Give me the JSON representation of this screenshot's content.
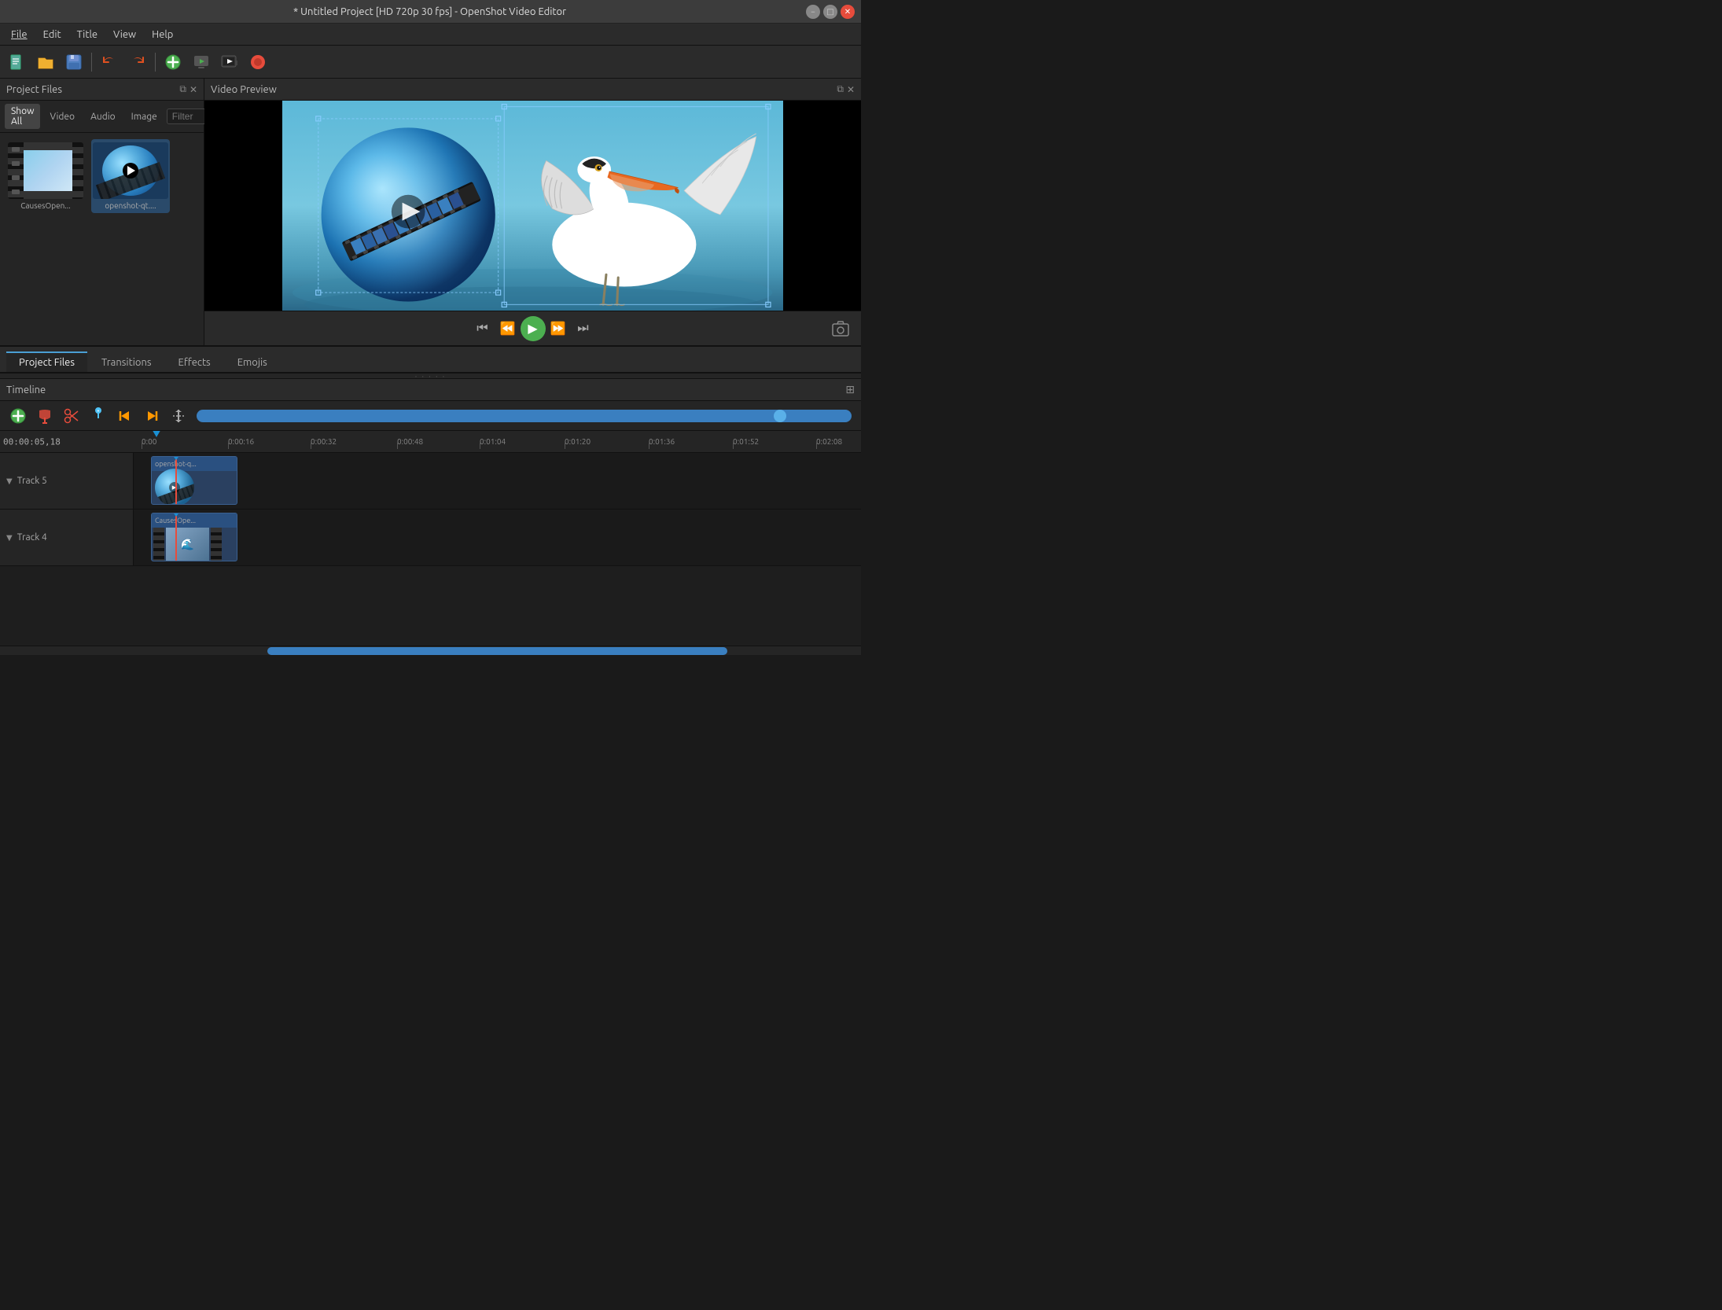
{
  "window": {
    "title": "* Untitled Project [HD 720p 30 fps] - OpenShot Video Editor",
    "minimize": "−",
    "maximize": "□",
    "close": "✕"
  },
  "menubar": {
    "items": [
      "File",
      "Edit",
      "Title",
      "View",
      "Help"
    ]
  },
  "toolbar": {
    "buttons": [
      {
        "name": "new",
        "icon": "📄",
        "label": "New"
      },
      {
        "name": "open",
        "icon": "📂",
        "label": "Open"
      },
      {
        "name": "save",
        "icon": "💾",
        "label": "Save"
      },
      {
        "name": "undo",
        "icon": "↩",
        "label": "Undo"
      },
      {
        "name": "redo",
        "icon": "↪",
        "label": "Redo"
      },
      {
        "name": "add",
        "icon": "➕",
        "label": "Add"
      },
      {
        "name": "preview",
        "icon": "▶",
        "label": "Preview"
      },
      {
        "name": "export",
        "icon": "📽",
        "label": "Export"
      },
      {
        "name": "record",
        "icon": "⏺",
        "label": "Record"
      }
    ]
  },
  "project_files_panel": {
    "title": "Project Files",
    "filters": [
      "Show All",
      "Video",
      "Audio",
      "Image"
    ],
    "active_filter": "Show All",
    "filter_placeholder": "Filter",
    "files": [
      {
        "name": "CausesOpen...",
        "type": "video"
      },
      {
        "name": "openshot-qt....",
        "type": "logo"
      }
    ]
  },
  "video_preview": {
    "title": "Video Preview",
    "controls": {
      "rewind_to_start": "⏮",
      "rewind": "◀◀",
      "play": "▶",
      "fast_forward": "▶▶",
      "forward_to_end": "⏭"
    }
  },
  "bottom_tabs": {
    "tabs": [
      "Project Files",
      "Transitions",
      "Effects",
      "Emojis"
    ],
    "active": "Project Files"
  },
  "timeline": {
    "title": "Timeline",
    "time_display": "00:00:05,18",
    "markers": [
      "0:00",
      "0:00:16",
      "0:00:32",
      "0:00:48",
      "0:01:04",
      "0:01:20",
      "0:01:36",
      "0:01:52",
      "0:02:08"
    ],
    "tracks": [
      {
        "name": "Track 5",
        "clips": [
          {
            "label": "openshot-q...",
            "type": "logo",
            "left_pct": 2,
            "width_pct": 10
          }
        ]
      },
      {
        "name": "Track 4",
        "clips": [
          {
            "label": "CausesOpe...",
            "type": "video",
            "left_pct": 2,
            "width_pct": 10
          }
        ]
      }
    ],
    "playhead_pct": 4
  }
}
